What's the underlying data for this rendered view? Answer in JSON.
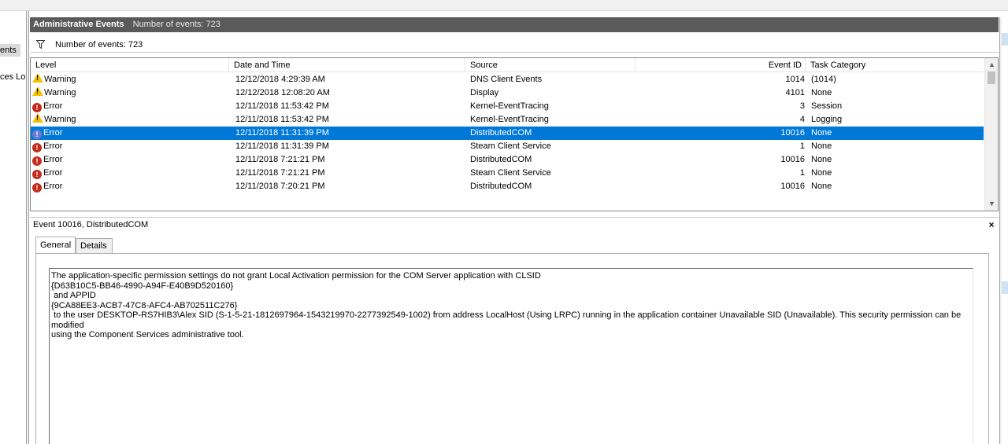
{
  "left_tree": {
    "item_a": "ents",
    "item_b": "ces Lo"
  },
  "title_bar": {
    "title": "Administrative Events",
    "subtitle": "Number of events: 723"
  },
  "filter_bar": {
    "icon": "filter-icon",
    "text": "Number of events: 723"
  },
  "columns": {
    "level": "Level",
    "date": "Date and Time",
    "source": "Source",
    "event_id": "Event ID",
    "task_category": "Task Category"
  },
  "events": [
    {
      "level": "Warning",
      "icon": "warning-icon",
      "date": "12/12/2018 4:29:39 AM",
      "source": "DNS Client Events",
      "event_id": "1014",
      "task_category": "(1014)"
    },
    {
      "level": "Warning",
      "icon": "warning-icon",
      "date": "12/12/2018 12:08:20 AM",
      "source": "Display",
      "event_id": "4101",
      "task_category": "None"
    },
    {
      "level": "Error",
      "icon": "error-icon",
      "date": "12/11/2018 11:53:42 PM",
      "source": "Kernel-EventTracing",
      "event_id": "3",
      "task_category": "Session"
    },
    {
      "level": "Warning",
      "icon": "warning-icon",
      "date": "12/11/2018 11:53:42 PM",
      "source": "Kernel-EventTracing",
      "event_id": "4",
      "task_category": "Logging"
    },
    {
      "level": "Error",
      "icon": "error-icon",
      "date": "12/11/2018 11:31:39 PM",
      "source": "DistributedCOM",
      "event_id": "10016",
      "task_category": "None",
      "selected": true
    },
    {
      "level": "Error",
      "icon": "error-icon",
      "date": "12/11/2018 11:31:39 PM",
      "source": "Steam Client Service",
      "event_id": "1",
      "task_category": "None"
    },
    {
      "level": "Error",
      "icon": "error-icon",
      "date": "12/11/2018 7:21:21 PM",
      "source": "DistributedCOM",
      "event_id": "10016",
      "task_category": "None"
    },
    {
      "level": "Error",
      "icon": "error-icon",
      "date": "12/11/2018 7:21:21 PM",
      "source": "Steam Client Service",
      "event_id": "1",
      "task_category": "None"
    },
    {
      "level": "Error",
      "icon": "error-icon",
      "date": "12/11/2018 7:20:21 PM",
      "source": "DistributedCOM",
      "event_id": "10016",
      "task_category": "None"
    }
  ],
  "detail": {
    "header": "Event 10016, DistributedCOM",
    "close_icon": "×",
    "tabs": [
      "General",
      "Details"
    ],
    "active_tab": "General",
    "description": "The application-specific permission settings do not grant Local Activation permission for the COM Server application with CLSID\n{D63B10C5-BB46-4990-A94F-E40B9D520160}\n and APPID\n{9CA88EE3-ACB7-47C8-AFC4-AB702511C276}\n to the user DESKTOP-RS7HIB3\\Alex SID (S-1-5-21-1812697964-1543219970-2277392549-1002) from address LocalHost (Using LRPC) running in the application container Unavailable SID (Unavailable). This security permission can be modified\nusing the Component Services administrative tool."
  },
  "colors": {
    "title_bar_bg": "#5a5a5a",
    "selection_bg": "#0078d7",
    "warning": "#f5c000",
    "error": "#c42b1c"
  }
}
